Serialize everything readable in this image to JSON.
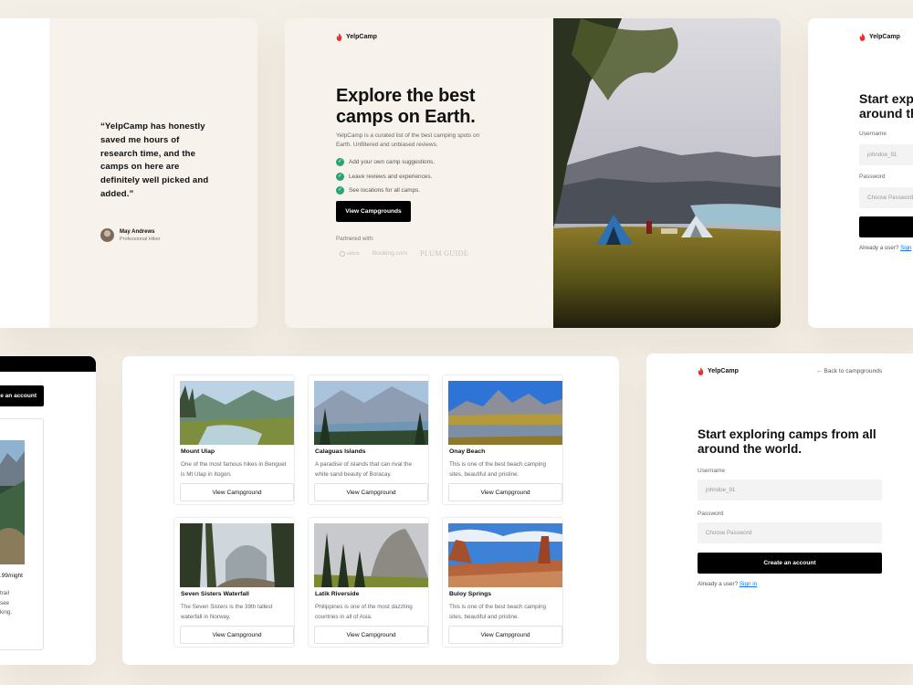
{
  "brand": {
    "name": "YelpCamp",
    "accent": "#e5322d",
    "check_color": "#2aa275",
    "link_color": "#1a73e8"
  },
  "testimonial": {
    "quote": "“YelpCamp has honestly saved me hours of research time, and the camps on here are definitely well picked and added.”",
    "author_name": "May Andrews",
    "author_role": "Professional Hiker"
  },
  "landing": {
    "title": "Explore the best camps on Earth.",
    "description": "YelpCamp is a curated list of the best camping spots on Earth. Unfiltered and unbiased reviews.",
    "features": [
      "Add your own camp suggestions.",
      "Leave reviews and experiences.",
      "See locations for all camps."
    ],
    "cta_label": "View Campgrounds",
    "partners_label": "Partnered with:",
    "partners": [
      "airbnb",
      "Booking.com",
      "PLUM GUIDE"
    ]
  },
  "login_top": {
    "title_line1": "Start exp",
    "title_line2": "around th",
    "username_label": "Username",
    "username_placeholder": "johndoe_91",
    "password_label": "Password",
    "password_placeholder": "Choose Password",
    "hint": "Already a user?",
    "hint_link": "Sign"
  },
  "detail": {
    "create_label": "e an account",
    "price": ".99/night",
    "text_lines": [
      "trail",
      "see",
      "king."
    ]
  },
  "campgrounds": [
    {
      "name": "Mount Ulap",
      "description": "One of the most famous hikes in Benguet is Mt Ulap in Itogon.",
      "button": "View Campground"
    },
    {
      "name": "Calaguas Islands",
      "description": "A paradise of islands that can rival the white sand beauty of Boracay.",
      "button": "View Campground"
    },
    {
      "name": "Onay Beach",
      "description": "This is one of the best beach camping sites, beautiful and pristine.",
      "button": "View Campground"
    },
    {
      "name": "Seven Sisters Waterfall",
      "description": "The Seven Sisters is the 39th tallest waterfall in Norway.",
      "button": "View Campground"
    },
    {
      "name": "Latik Riverside",
      "description": "Philippines is one of the most dazzling countries in all of Asia.",
      "button": "View Campground"
    },
    {
      "name": "Buloy Springs",
      "description": "This is one of the best beach camping sites, beautiful and pristine.",
      "button": "View Campground"
    }
  ],
  "signup": {
    "back_link": "← Back to campgrounds",
    "title": "Start exploring camps from all around the world.",
    "username_label": "Username",
    "username_placeholder": "johndoe_91",
    "password_label": "Password",
    "password_placeholder": "Choose Password",
    "submit_label": "Create an account",
    "hint": "Already a user?",
    "hint_link": "Sign in"
  }
}
